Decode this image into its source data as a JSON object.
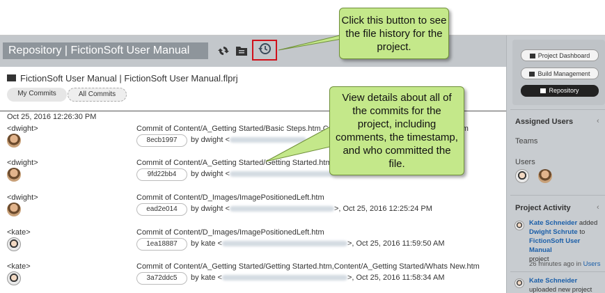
{
  "header": {
    "title": "Repository | FictionSoft User Manual",
    "icons": [
      "sync-icon",
      "folder-icon",
      "history-icon"
    ]
  },
  "project": {
    "line": "FictionSoft User Manual | FictionSoft User Manual.flprj"
  },
  "tabs": {
    "my_commits": "My Commits",
    "all_commits": "All Commits"
  },
  "date_header": "Oct 25, 2016 12:26:30 PM",
  "commits": [
    {
      "user": "<dwight>",
      "avatar": "dwight",
      "message": "Commit of Content/A_Getting Started/Basic Steps.htm,Content/A_Getting Started/Whats New.htm",
      "hash": "8ecb1997",
      "by_prefix": "by dwight <",
      "by_suffix": ""
    },
    {
      "user": "<dwight>",
      "avatar": "dwight",
      "message": "Commit of Content/A_Getting Started/Getting Started.htm",
      "hash": "9fd22bb4",
      "by_prefix": "by dwight <",
      "by_suffix": ""
    },
    {
      "user": "<dwight>",
      "avatar": "dwight",
      "message": "Commit of Content/D_Images/ImagePositionedLeft.htm",
      "hash": "ead2e014",
      "by_prefix": "by dwight <",
      "by_suffix": ">, Oct 25, 2016 12:25:24 PM"
    },
    {
      "user": "<kate>",
      "avatar": "kate",
      "message": "Commit of Content/D_Images/ImagePositionedLeft.htm",
      "hash": "1ea18887",
      "by_prefix": "by kate <",
      "by_suffix": ">, Oct 25, 2016 11:59:50 AM"
    },
    {
      "user": "<kate>",
      "avatar": "kate",
      "message": "Commit of Content/A_Getting Started/Getting Started.htm,Content/A_Getting Started/Whats New.htm",
      "hash": "3a72ddc5",
      "by_prefix": "by kate <",
      "by_suffix": ">, Oct 25, 2016 11:58:34 AM"
    }
  ],
  "right_panel": {
    "buttons": [
      "Project Dashboard",
      "Build Management",
      "Repository"
    ],
    "assigned_users": "Assigned Users",
    "teams": "Teams",
    "users": "Users",
    "project_activity": "Project Activity",
    "activity": {
      "actor": "Kate Schneider",
      "verb": "added",
      "target": "Dwight Schrute",
      "to": "to",
      "project": "FictionSoft User Manual",
      "suffix": "project",
      "time": "26 minutes ago in",
      "time_link": "Users",
      "actor2": "Kate Schneider",
      "verb2": "uploaded new project"
    }
  },
  "callouts": {
    "history": "Click this button to see the file history for the project.",
    "details": "View details about all of the commits for the project, including comments, the timestamp, and who committed the file."
  },
  "colors": {
    "callout": "#c4e88a",
    "highlight": "#d0101a",
    "link": "#1a5ea8"
  }
}
